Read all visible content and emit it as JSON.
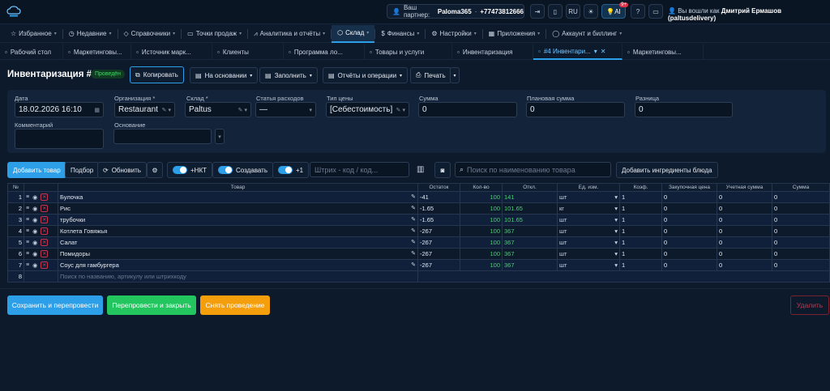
{
  "topbar": {
    "partner_label": "Ваш партнер:",
    "partner_name": "Paloma365",
    "partner_phone": "+77473812666",
    "lang": "RU",
    "ai_label": "AI",
    "ai_badge": "9+",
    "user_label": "Вы вошли как",
    "user_name": "Дмитрий Ермашов (paltusdelivery)"
  },
  "nav": {
    "items": [
      {
        "label": "Избранное",
        "icon": "star-icon"
      },
      {
        "label": "Недавние",
        "icon": "clock-icon"
      },
      {
        "label": "Справочники",
        "icon": "tag-icon"
      },
      {
        "label": "Точки продаж",
        "icon": "monitor-icon"
      },
      {
        "label": "Аналитика и отчёты",
        "icon": "chart-icon"
      },
      {
        "label": "Склад",
        "icon": "box-icon",
        "active": true
      },
      {
        "label": "Финансы",
        "icon": "dollar-icon"
      },
      {
        "label": "Настройки",
        "icon": "gear-icon"
      },
      {
        "label": "Приложения",
        "icon": "apps-icon"
      },
      {
        "label": "Аккаунт и биллинг",
        "icon": "user-icon"
      }
    ]
  },
  "tabs": [
    {
      "label": "Рабочий стол"
    },
    {
      "label": "Маркетинговы..."
    },
    {
      "label": "Источник марк..."
    },
    {
      "label": "Клиенты"
    },
    {
      "label": "Программа ло..."
    },
    {
      "label": "Товары и услуги"
    },
    {
      "label": "Инвентаризация"
    },
    {
      "label": "#4 Инвентари...",
      "active": true
    },
    {
      "label": "Маркетинговы..."
    }
  ],
  "header": {
    "title": "Инвентаризация #4",
    "status": "Проведён",
    "copy": "Копировать",
    "based_on": "На основании",
    "fill": "Заполнить",
    "reports": "Отчёты и операции",
    "print": "Печать"
  },
  "form": {
    "date_label": "Дата",
    "date_value": "18.02.2026 16:10",
    "org_label": "Организация *",
    "org_value": "Restaurant",
    "warehouse_label": "Склад *",
    "warehouse_value": "Paltus",
    "expense_label": "Статья расходов",
    "expense_value": "—",
    "price_type_label": "Тип цены",
    "price_type_value": "[Себестоимость]",
    "sum_label": "Сумма",
    "sum_value": "0",
    "plan_sum_label": "Плановая сумма",
    "plan_sum_value": "0",
    "diff_label": "Разница",
    "diff_value": "0",
    "comment_label": "Комментарий",
    "basis_label": "Основание"
  },
  "toolbar": {
    "add_product": "Добавить товар",
    "selection": "Подбор",
    "refresh": "Обновить",
    "nkt": "+НКТ",
    "create": "Создавать",
    "plus_one": "+1",
    "barcode_placeholder": "Штрих - код / код...",
    "search_placeholder": "Поиск по наименованию товара",
    "add_ingredients": "Добавить ингредиенты блюда"
  },
  "table": {
    "headers": [
      "№",
      "Товар",
      "Остаток",
      "Кол-во",
      "Откл.",
      "Ед. изм.",
      "Коэф.",
      "Закупочная цена",
      "Учетная сумма",
      "Сумма"
    ],
    "rows": [
      {
        "n": "1",
        "name": "Булочка",
        "stock": "-41",
        "qty": "100",
        "dev": "141",
        "unit": "шт",
        "coef": "1",
        "purchase": "0",
        "acc": "0",
        "sum": "0"
      },
      {
        "n": "2",
        "name": "Рис",
        "stock": "-1.65",
        "qty": "100",
        "dev": "101.65",
        "unit": "кг",
        "coef": "1",
        "purchase": "0",
        "acc": "0",
        "sum": "0"
      },
      {
        "n": "3",
        "name": "трубочки",
        "stock": "-1.65",
        "qty": "100",
        "dev": "101.65",
        "unit": "шт",
        "coef": "1",
        "purchase": "0",
        "acc": "0",
        "sum": "0"
      },
      {
        "n": "4",
        "name": "Котлета Говяжья",
        "stock": "-267",
        "qty": "100",
        "dev": "367",
        "unit": "шт",
        "coef": "1",
        "purchase": "0",
        "acc": "0",
        "sum": "0"
      },
      {
        "n": "5",
        "name": "Салат",
        "stock": "-267",
        "qty": "100",
        "dev": "367",
        "unit": "шт",
        "coef": "1",
        "purchase": "0",
        "acc": "0",
        "sum": "0"
      },
      {
        "n": "6",
        "name": "Помидоры",
        "stock": "-267",
        "qty": "100",
        "dev": "367",
        "unit": "шт",
        "coef": "1",
        "purchase": "0",
        "acc": "0",
        "sum": "0"
      },
      {
        "n": "7",
        "name": "Соус для гамбургера",
        "stock": "-267",
        "qty": "100",
        "dev": "367",
        "unit": "шт",
        "coef": "1",
        "purchase": "0",
        "acc": "0",
        "sum": "0"
      }
    ],
    "new_row_n": "8",
    "new_row_placeholder": "Поиск по названию, артикулу или штрихкоду"
  },
  "footer": {
    "save_repost": "Сохранить и перепровести",
    "repost_close": "Перепровести и закрыть",
    "unpost": "Снять проведение",
    "delete": "Удалить"
  },
  "colors": {
    "accent": "#2d9ee8",
    "success": "#22c55e",
    "warning": "#f59e0b",
    "danger": "#e0304a",
    "background": "#0d1a2c"
  }
}
